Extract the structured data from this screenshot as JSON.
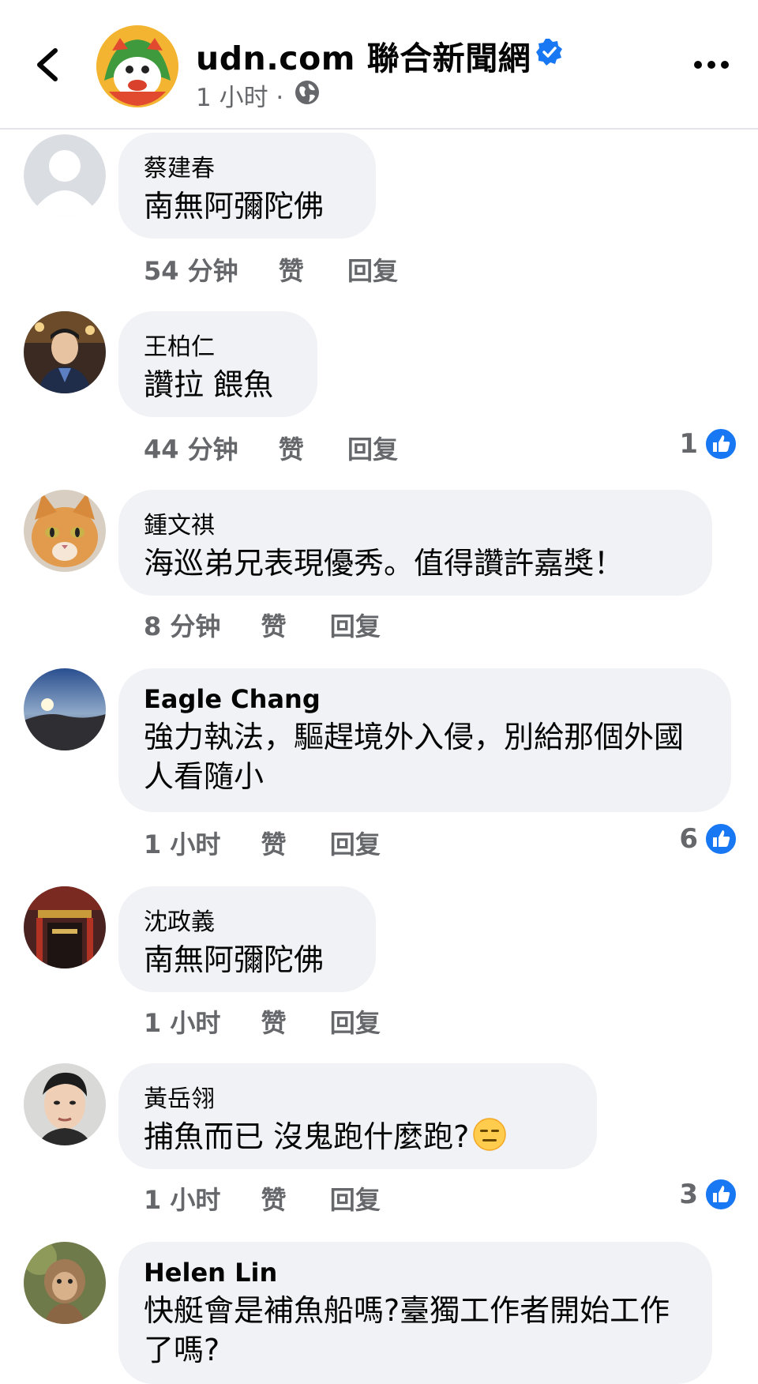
{
  "header": {
    "page_name": "udn.com 聯合新聞網",
    "post_time": "1 小时 ·",
    "icons": {
      "back": "back-arrow-icon",
      "verified": "verified-badge-icon",
      "globe": "globe-icon",
      "more": "more-options-icon"
    },
    "colors": {
      "verified": "#1877f2",
      "divider": "#e4e6eb"
    }
  },
  "comments": [
    {
      "author": "蔡建春",
      "text": "南無阿彌陀佛",
      "time": "54 分钟",
      "like": "赞",
      "reply": "回复",
      "reactions": ""
    },
    {
      "author": "王柏仁",
      "text": "讚拉 餵魚",
      "time": "44 分钟",
      "like": "赞",
      "reply": "回复",
      "reactions": "1"
    },
    {
      "author": "鍾文祺",
      "text": "海巡弟兄表現優秀。值得讚許嘉獎！",
      "time": "8 分钟",
      "like": "赞",
      "reply": "回复",
      "reactions": ""
    },
    {
      "author": "Eagle Chang",
      "text": "強力執法，驅趕境外入侵，別給那個外國人看隨小",
      "time": "1 小时",
      "like": "赞",
      "reply": "回复",
      "reactions": "6"
    },
    {
      "author": "沈政義",
      "text": "南無阿彌陀佛",
      "time": "1 小时",
      "like": "赞",
      "reply": "回复",
      "reactions": ""
    },
    {
      "author": "黃岳翎",
      "text": "捕魚而已 沒鬼跑什麼跑?",
      "time": "1 小时",
      "like": "赞",
      "reply": "回复",
      "reactions": "3"
    },
    {
      "author": "Helen Lin",
      "text": "快艇會是補魚船嗎?臺獨工作者開始工作了嗎?",
      "time": "",
      "like": "",
      "reply": "",
      "reactions": ""
    }
  ],
  "colors": {
    "bubble": "#f0f2f5",
    "secondary_text": "#65676b",
    "like_blue": "#1877f2"
  }
}
